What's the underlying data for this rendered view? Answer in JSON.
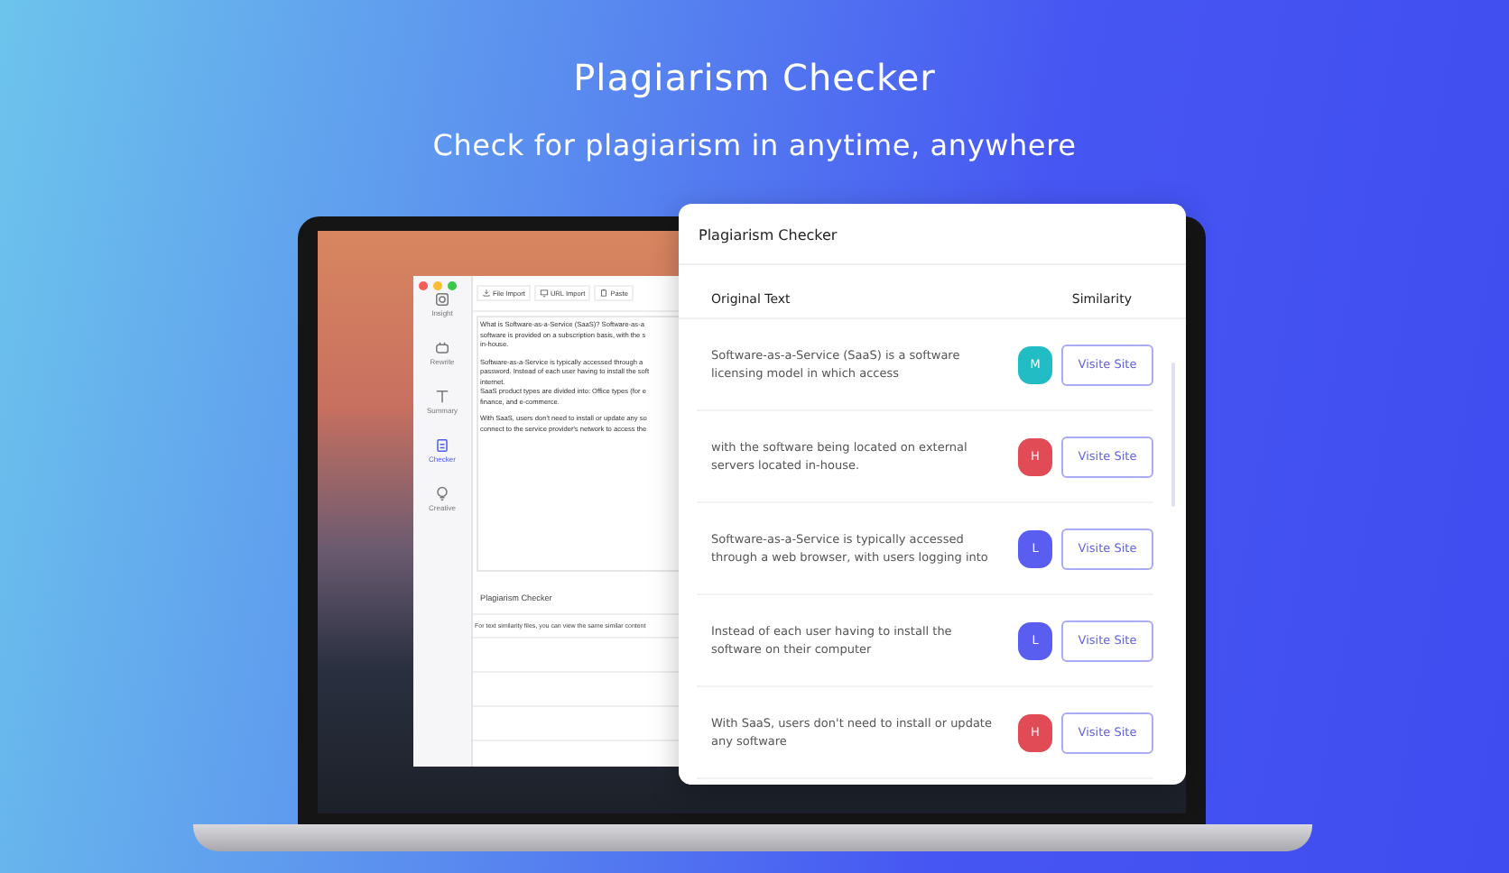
{
  "hero": {
    "title": "Plagiarism Checker",
    "subtitle": "Check for plagiarism in anytime, anywhere"
  },
  "app": {
    "sidebar": [
      {
        "label": "Insight",
        "selected": false
      },
      {
        "label": "Rewrite",
        "selected": false
      },
      {
        "label": "Summary",
        "selected": false
      },
      {
        "label": "Checker",
        "selected": true
      },
      {
        "label": "Creative",
        "selected": false
      }
    ],
    "toolbar": [
      "File Import",
      "URL Import",
      "Paste"
    ],
    "editor_paragraphs": [
      [
        "What is Software-as-a-Service (SaaS)? Software-as-a",
        "software is provided on a subscription basis, with the s",
        "in-house."
      ],
      [
        "Software-as-a-Service is typically accessed through a",
        "password. Instead of each user having to install the soft",
        "internet.",
        "SaaS product types are divided into: Office types (for e",
        "finance, and e-commerce."
      ],
      [
        "With SaaS, users don't need to install or update any so",
        "connect to the service provider's network to access the"
      ]
    ],
    "panel_title": "Plagiarism Checker",
    "panel_note": "For text similarity files, you can view the same similar content"
  },
  "card": {
    "title": "Plagiarism Checker",
    "columns": [
      "Original Text",
      "Similarity"
    ],
    "rows": [
      {
        "text": "Software-as-a-Service (SaaS) is a software licensing model in which access",
        "level_letter": "M",
        "color": "#22bcc4",
        "button": "Visite Site"
      },
      {
        "text": "with the software being located on external servers located in-house.",
        "level_letter": "H",
        "color": "#e04b55",
        "button": "Visite Site"
      },
      {
        "text": "Software-as-a-Service is typically accessed through a web browser, with users logging into",
        "level_letter": "L",
        "color": "#5a5ef0",
        "button": "Visite Site"
      },
      {
        "text": "Instead of each user having to install the software on their computer",
        "level_letter": "L",
        "color": "#5a5ef0",
        "button": "Visite Site"
      },
      {
        "text": "With SaaS, users don't need to install or update any software",
        "level_letter": "H",
        "color": "#e04b55",
        "button": "Visite Site"
      }
    ]
  }
}
